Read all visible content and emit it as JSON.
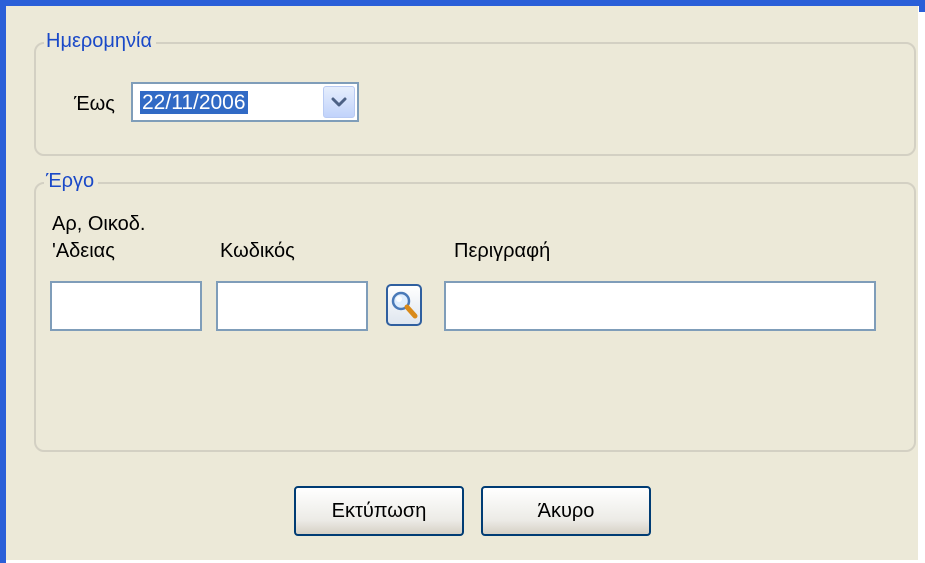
{
  "date_group": {
    "legend": "Ημερομηνία",
    "until_label": "Έως",
    "until_value": "22/11/2006"
  },
  "project_group": {
    "legend": "Έργο",
    "permit_label_line1": "Αρ, Οικοδ.",
    "permit_label_line2": "'Αδειας",
    "code_label": "Κωδικός",
    "description_label": "Περιγραφή",
    "permit_value": "",
    "code_value": "",
    "description_value": ""
  },
  "buttons": {
    "print_label": "Εκτύπωση",
    "cancel_label": "Άκυρο"
  },
  "icons": {
    "dropdown": "chevron-down-icon",
    "search": "magnifier-icon"
  },
  "colors": {
    "legend_text": "#1a49c8",
    "selection_bg": "#316ac5",
    "window_frame": "#2a5fd8"
  }
}
